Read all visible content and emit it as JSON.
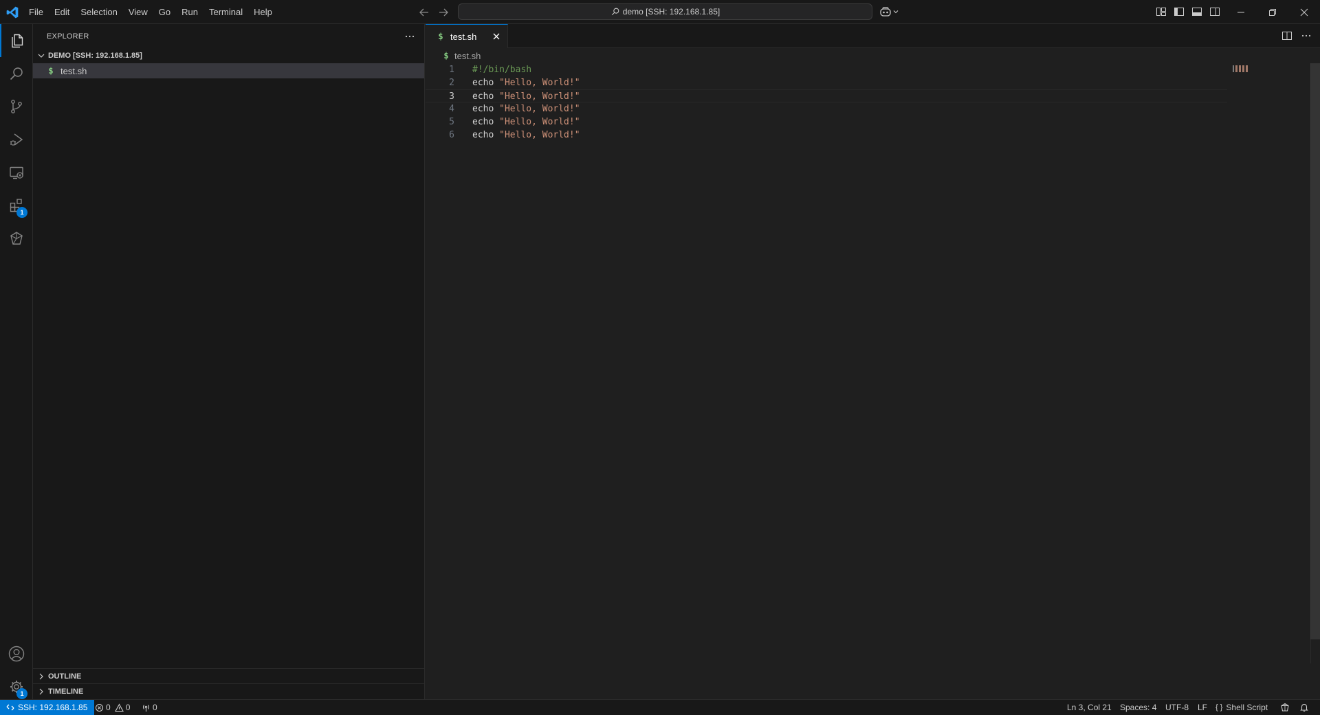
{
  "titlebar": {
    "menu": [
      "File",
      "Edit",
      "Selection",
      "View",
      "Go",
      "Run",
      "Terminal",
      "Help"
    ],
    "command_center": "demo [SSH: 192.168.1.85]"
  },
  "activity_bar": {
    "extensions_badge": "1",
    "manage_badge": "1"
  },
  "sidebar": {
    "title": "EXPLORER",
    "workspace": "DEMO [SSH: 192.168.1.85]",
    "file_icon": "$",
    "files": [
      "test.sh"
    ],
    "outline": "OUTLINE",
    "timeline": "TIMELINE"
  },
  "editor": {
    "tab_icon": "$",
    "tab_label": "test.sh",
    "breadcrumb_icon": "$",
    "breadcrumb": "test.sh",
    "lines": [
      {
        "num": "1",
        "tokens": [
          {
            "t": "comment",
            "v": "#!/bin/bash"
          }
        ]
      },
      {
        "num": "2",
        "tokens": [
          {
            "t": "builtin",
            "v": "echo"
          },
          {
            "t": "plain",
            "v": " "
          },
          {
            "t": "string",
            "v": "\"Hello, World!\""
          }
        ]
      },
      {
        "num": "3",
        "tokens": [
          {
            "t": "builtin",
            "v": "echo"
          },
          {
            "t": "plain",
            "v": " "
          },
          {
            "t": "string",
            "v": "\"Hello, World!\""
          }
        ]
      },
      {
        "num": "4",
        "tokens": [
          {
            "t": "builtin",
            "v": "echo"
          },
          {
            "t": "plain",
            "v": " "
          },
          {
            "t": "string",
            "v": "\"Hello, World!\""
          }
        ]
      },
      {
        "num": "5",
        "tokens": [
          {
            "t": "builtin",
            "v": "echo"
          },
          {
            "t": "plain",
            "v": " "
          },
          {
            "t": "string",
            "v": "\"Hello, World!\""
          }
        ]
      },
      {
        "num": "6",
        "tokens": [
          {
            "t": "builtin",
            "v": "echo"
          },
          {
            "t": "plain",
            "v": " "
          },
          {
            "t": "string",
            "v": "\"Hello, World!\""
          }
        ]
      }
    ],
    "current_line": 3
  },
  "statusbar": {
    "remote": "SSH: 192.168.1.85",
    "errors": "0",
    "warnings": "0",
    "ports": "0",
    "position": "Ln 3, Col 21",
    "spaces": "Spaces: 4",
    "encoding": "UTF-8",
    "eol": "LF",
    "language_icon": "{ }",
    "language": "Shell Script"
  },
  "colors": {
    "accent": "#0078d4",
    "string": "#ce9178",
    "comment": "#6a9955",
    "shell_icon": "#89d185"
  }
}
